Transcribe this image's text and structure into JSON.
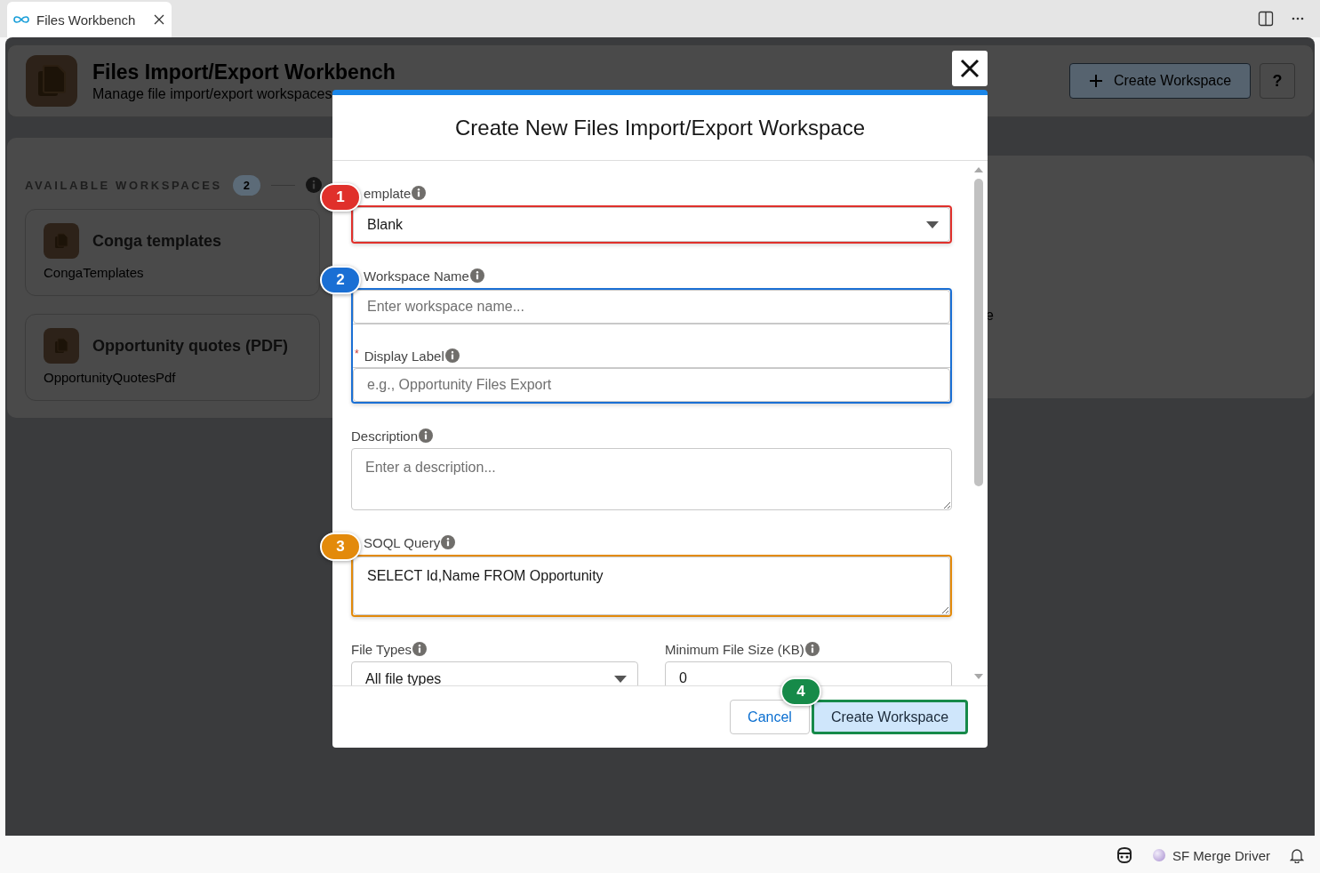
{
  "editor_tab": {
    "title": "Files Workbench"
  },
  "page": {
    "title": "Files Import/Export Workbench",
    "subtitle": "Manage file import/export workspaces",
    "create_button": "Create Workspace",
    "help_button": "?"
  },
  "workspaces": {
    "heading": "AVAILABLE WORKSPACES",
    "count": "2",
    "items": [
      {
        "name": "Conga templates",
        "api_name": "CongaTemplates"
      },
      {
        "name": "Opportunity quotes (PDF)",
        "api_name": "OpportunityQuotesPdf"
      }
    ]
  },
  "right_panel": {
    "fragment": "e"
  },
  "modal": {
    "title": "Create New Files Import/Export Workspace",
    "sections": [
      {
        "kind": "stack",
        "annotation": {
          "number": "1",
          "color": "#e0302b"
        },
        "fields": [
          {
            "label": "emplate",
            "kind": "select",
            "value": "Blank"
          }
        ]
      },
      {
        "kind": "stack",
        "annotation": {
          "number": "2",
          "color": "#1a6fd4"
        },
        "fields": [
          {
            "label": "Workspace Name",
            "kind": "input",
            "placeholder": "Enter workspace name..."
          },
          {
            "label": "Display Label",
            "required_mark": "*",
            "kind": "input",
            "placeholder": "e.g., Opportunity Files Export"
          }
        ]
      },
      {
        "kind": "stack",
        "fields": [
          {
            "label": "Description",
            "kind": "textarea",
            "placeholder": "Enter a description..."
          }
        ]
      },
      {
        "kind": "stack",
        "annotation": {
          "number": "3",
          "color": "#e38a0b"
        },
        "fields": [
          {
            "label": "SOQL Query",
            "kind": "textarea",
            "value": "SELECT Id,Name FROM Opportunity"
          }
        ]
      },
      {
        "kind": "columns",
        "fields": [
          {
            "label": "File Types",
            "kind": "select",
            "value": "All file types"
          },
          {
            "label": "Minimum File Size (KB)",
            "kind": "input",
            "value": "0"
          }
        ]
      }
    ],
    "footer": {
      "buttons": [
        {
          "label": "Cancel",
          "kind": "neutral"
        },
        {
          "label": "Create Workspace",
          "kind": "brand",
          "annotation": {
            "number": "4",
            "color": "#168a49"
          }
        }
      ]
    }
  },
  "status_bar": {
    "items": [
      "SF Merge Driver"
    ]
  }
}
